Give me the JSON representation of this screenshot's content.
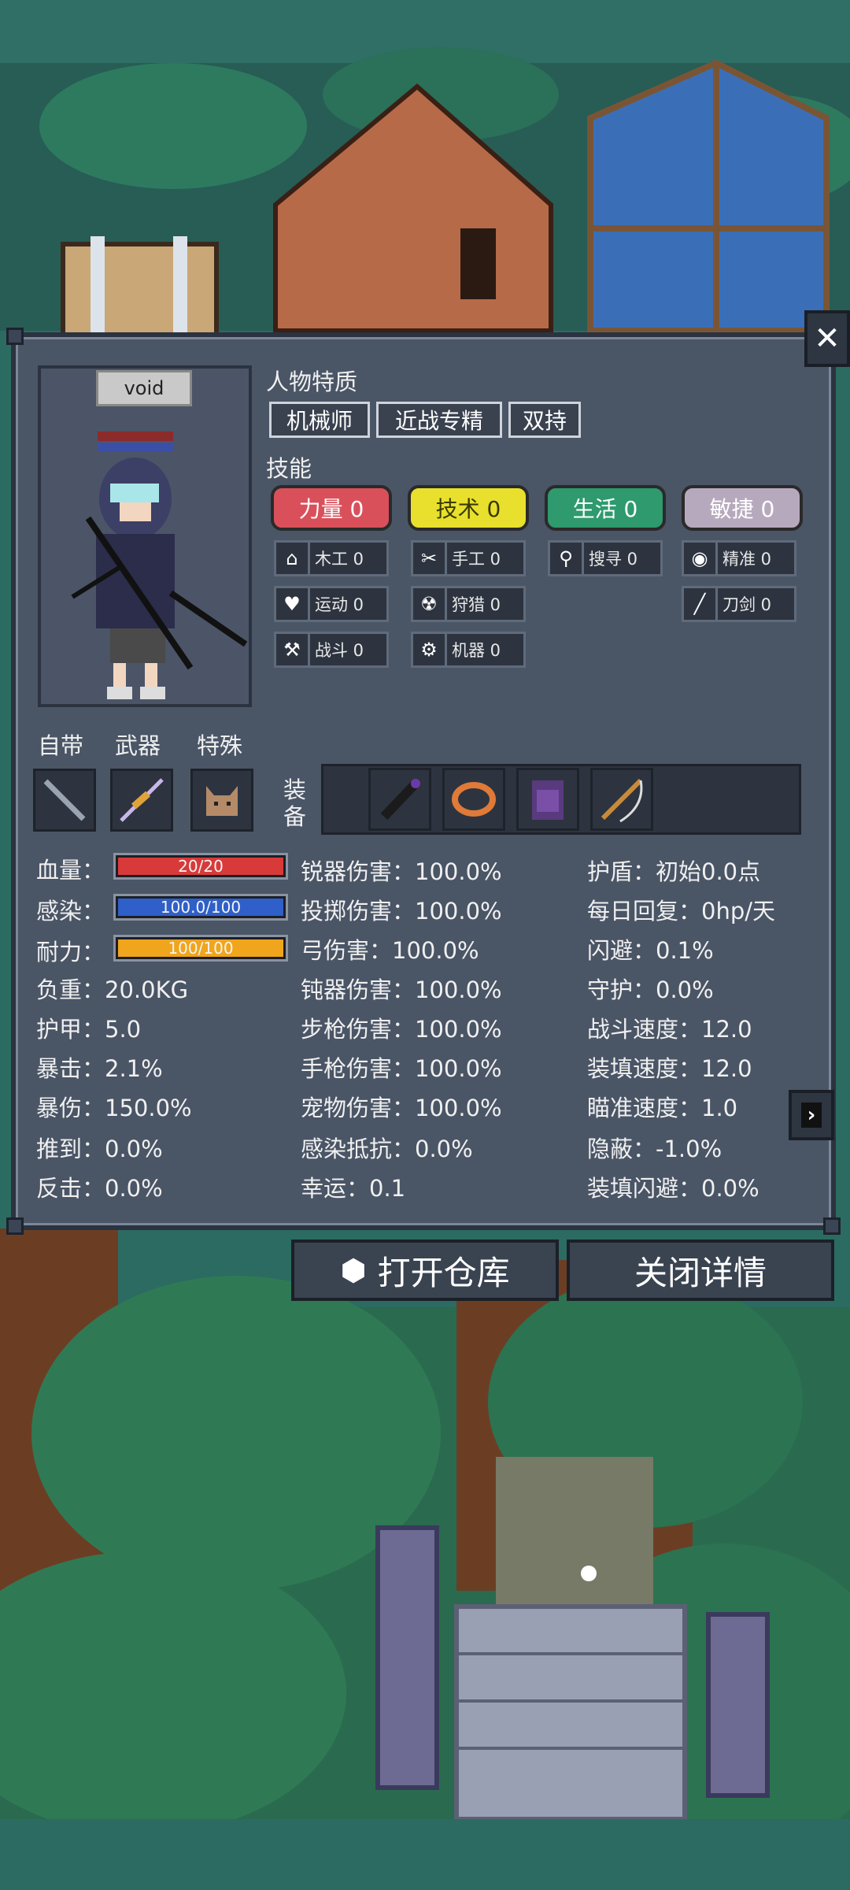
{
  "panel": {
    "close_icon": "close-x-icon",
    "character_name": "void",
    "traits_title": "人物特质",
    "traits": [
      "机械师",
      "近战专精",
      "双持"
    ],
    "skills_title": "技能",
    "skill_categories": [
      {
        "label": "力量 0",
        "bg": "#d9505b",
        "color": "#ffffff"
      },
      {
        "label": "技术 0",
        "bg": "#e8e02c",
        "color": "#3a3a00"
      },
      {
        "label": "生活 0",
        "bg": "#2e9a6e",
        "color": "#ffffff"
      },
      {
        "label": "敏捷 0",
        "bg": "#b7a9bd",
        "color": "#ffffff"
      }
    ],
    "sub_skills": [
      {
        "label": "木工 0",
        "icon": "house-icon"
      },
      {
        "label": "运动 0",
        "icon": "heart-icon"
      },
      {
        "label": "战斗 0",
        "icon": "axe-icon"
      },
      {
        "label": "手工 0",
        "icon": "scissors-icon"
      },
      {
        "label": "狩猎 0",
        "icon": "radiation-icon"
      },
      {
        "label": "机器 0",
        "icon": "gear-icon"
      },
      {
        "label": "搜寻 0",
        "icon": "magnifier-icon"
      },
      {
        "label": "精准 0",
        "icon": "eye-icon"
      },
      {
        "label": "刀剑 0",
        "icon": "blade-icon"
      }
    ],
    "slot_labels": {
      "self": "自带",
      "weapon": "武器",
      "special": "特殊",
      "equip": "装备"
    },
    "bars": [
      {
        "label": "血量：",
        "value": "20/20",
        "fill": 1.0,
        "color": "#d83a3a"
      },
      {
        "label": "感染：",
        "value": "100.0/100",
        "fill": 1.0,
        "color": "#2f5fc8"
      },
      {
        "label": "耐力：",
        "value": "100/100",
        "fill": 1.0,
        "color": "#f0a51c"
      }
    ],
    "col1_stats": [
      "负重：20.0KG",
      "护甲：5.0",
      "暴击：2.1%",
      "暴伤：150.0%",
      "推到：0.0%",
      "反击：0.0%"
    ],
    "col2_stats": [
      "锐器伤害：100.0%",
      "投掷伤害：100.0%",
      "弓伤害：100.0%",
      "钝器伤害：100.0%",
      "步枪伤害：100.0%",
      "手枪伤害：100.0%",
      "宠物伤害：100.0%",
      "感染抵抗：0.0%",
      "幸运：0.1"
    ],
    "col3_stats": [
      "护盾：初始0.0点",
      "每日回复：0hp/天",
      "闪避：0.1%",
      "守护：0.0%",
      "战斗速度：12.0",
      "装填速度：12.0",
      "瞄准速度：1.0",
      "隐蔽：-1.0%",
      "装填闪避：0.0%"
    ],
    "next_icon": "chevron-right-icon"
  },
  "buttons": {
    "open_storage": "打开仓库",
    "close_details": "关闭详情"
  }
}
